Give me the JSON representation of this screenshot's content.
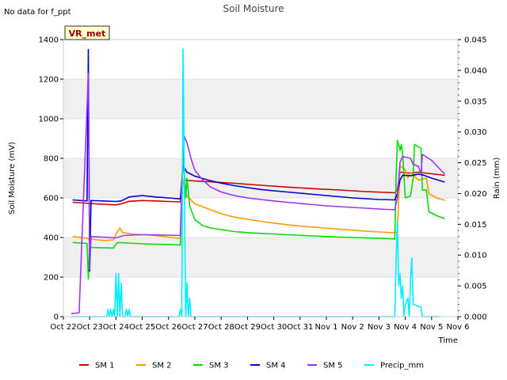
{
  "top_note": "No data for f_ppt",
  "station_badge": "VR_met",
  "chart_data": {
    "type": "line",
    "title": "Soil Moisture",
    "xlabel": "Time",
    "ylabel": "Soil Moisture (mV)",
    "y2label": "Rain (mm)",
    "x_tick_labels": [
      "Oct 22",
      "Oct 23",
      "Oct 24",
      "Oct 25",
      "Oct 26",
      "Oct 27",
      "Oct 28",
      "Oct 29",
      "Oct 30",
      "Oct 31",
      "Nov 1",
      "Nov 2",
      "Nov 3",
      "Nov 4",
      "Nov 5",
      "Nov 6"
    ],
    "xlim": [
      0,
      15
    ],
    "ylim": [
      0,
      1400
    ],
    "y_ticks": [
      0,
      200,
      400,
      600,
      800,
      1000,
      1200,
      1400
    ],
    "y2lim": [
      0,
      0.045
    ],
    "y2_ticks": [
      "0.000",
      "0.005",
      "0.010",
      "0.015",
      "0.020",
      "0.025",
      "0.030",
      "0.035",
      "0.040",
      "0.045"
    ],
    "grid": true,
    "legend_position": "bottom",
    "series": [
      {
        "name": "SM 1",
        "color": "#cc0000",
        "axis": "left",
        "points": [
          [
            0.35,
            578
          ],
          [
            1,
            572
          ],
          [
            1.5,
            568
          ],
          [
            2,
            565
          ],
          [
            2.2,
            570
          ],
          [
            2.5,
            583
          ],
          [
            3,
            587
          ],
          [
            3.5,
            585
          ],
          [
            4,
            582
          ],
          [
            4.45,
            580
          ],
          [
            4.55,
            690
          ],
          [
            4.7,
            688
          ],
          [
            5.5,
            682
          ],
          [
            6.5,
            674
          ],
          [
            7.5,
            664
          ],
          [
            8.5,
            655
          ],
          [
            9.5,
            647
          ],
          [
            10.5,
            640
          ],
          [
            11.5,
            632
          ],
          [
            12.6,
            626
          ],
          [
            12.7,
            640
          ],
          [
            12.8,
            730
          ],
          [
            13.2,
            725
          ],
          [
            13.5,
            730
          ],
          [
            14,
            722
          ],
          [
            14.5,
            714
          ]
        ]
      },
      {
        "name": "SM 2",
        "color": "#ff9900",
        "axis": "left",
        "points": [
          [
            0.35,
            405
          ],
          [
            0.8,
            398
          ],
          [
            1,
            392
          ],
          [
            1.3,
            388
          ],
          [
            1.6,
            385
          ],
          [
            1.9,
            388
          ],
          [
            2.05,
            430
          ],
          [
            2.15,
            448
          ],
          [
            2.25,
            425
          ],
          [
            2.6,
            418
          ],
          [
            3,
            415
          ],
          [
            3.5,
            410
          ],
          [
            4,
            402
          ],
          [
            4.45,
            395
          ],
          [
            4.55,
            690
          ],
          [
            4.7,
            610
          ],
          [
            5,
            570
          ],
          [
            5.5,
            545
          ],
          [
            6,
            520
          ],
          [
            6.5,
            503
          ],
          [
            7,
            492
          ],
          [
            7.5,
            482
          ],
          [
            8,
            473
          ],
          [
            8.5,
            465
          ],
          [
            9,
            458
          ],
          [
            9.5,
            452
          ],
          [
            10,
            447
          ],
          [
            10.5,
            442
          ],
          [
            11,
            437
          ],
          [
            11.5,
            432
          ],
          [
            12,
            428
          ],
          [
            12.6,
            424
          ],
          [
            12.7,
            430
          ],
          [
            12.8,
            760
          ],
          [
            13,
            745
          ],
          [
            13.1,
            700
          ],
          [
            13.2,
            730
          ],
          [
            13.5,
            690
          ],
          [
            13.8,
            700
          ],
          [
            13.9,
            620
          ],
          [
            14.2,
            600
          ],
          [
            14.5,
            588
          ]
        ]
      },
      {
        "name": "SM 3",
        "color": "#00dd00",
        "axis": "left",
        "points": [
          [
            0.35,
            375
          ],
          [
            0.9,
            370
          ],
          [
            0.95,
            190
          ],
          [
            1,
            350
          ],
          [
            1.5,
            348
          ],
          [
            1.9,
            347
          ],
          [
            2.05,
            375
          ],
          [
            2.5,
            372
          ],
          [
            3,
            368
          ],
          [
            3.5,
            366
          ],
          [
            4,
            365
          ],
          [
            4.45,
            362
          ],
          [
            4.5,
            660
          ],
          [
            4.55,
            850
          ],
          [
            4.65,
            600
          ],
          [
            4.7,
            700
          ],
          [
            4.8,
            560
          ],
          [
            5,
            490
          ],
          [
            5.3,
            460
          ],
          [
            5.6,
            448
          ],
          [
            6,
            440
          ],
          [
            6.5,
            430
          ],
          [
            7,
            425
          ],
          [
            7.5,
            421
          ],
          [
            8,
            418
          ],
          [
            8.5,
            414
          ],
          [
            9,
            411
          ],
          [
            9.5,
            408
          ],
          [
            10,
            405
          ],
          [
            10.5,
            402
          ],
          [
            11,
            400
          ],
          [
            11.5,
            398
          ],
          [
            12,
            396
          ],
          [
            12.6,
            393
          ],
          [
            12.65,
            700
          ],
          [
            12.7,
            890
          ],
          [
            12.75,
            870
          ],
          [
            12.8,
            840
          ],
          [
            12.85,
            870
          ],
          [
            12.9,
            820
          ],
          [
            13.0,
            600
          ],
          [
            13.2,
            610
          ],
          [
            13.3,
            700
          ],
          [
            13.35,
            870
          ],
          [
            13.6,
            850
          ],
          [
            13.65,
            640
          ],
          [
            13.8,
            640
          ],
          [
            13.9,
            530
          ],
          [
            14.2,
            510
          ],
          [
            14.5,
            495
          ]
        ]
      },
      {
        "name": "SM 4",
        "color": "#0000cc",
        "axis": "left",
        "points": [
          [
            0.35,
            590
          ],
          [
            0.9,
            585
          ],
          [
            0.95,
            1350
          ],
          [
            1.0,
            230
          ],
          [
            1.05,
            587
          ],
          [
            1.5,
            585
          ],
          [
            2,
            582
          ],
          [
            2.2,
            585
          ],
          [
            2.5,
            605
          ],
          [
            3,
            612
          ],
          [
            3.5,
            605
          ],
          [
            4,
            600
          ],
          [
            4.45,
            595
          ],
          [
            4.55,
            760
          ],
          [
            4.7,
            730
          ],
          [
            5,
            710
          ],
          [
            5.5,
            690
          ],
          [
            6,
            675
          ],
          [
            6.5,
            662
          ],
          [
            7,
            652
          ],
          [
            7.5,
            643
          ],
          [
            8,
            636
          ],
          [
            8.5,
            630
          ],
          [
            9,
            624
          ],
          [
            9.5,
            618
          ],
          [
            10,
            612
          ],
          [
            10.5,
            606
          ],
          [
            11,
            600
          ],
          [
            11.5,
            596
          ],
          [
            12,
            592
          ],
          [
            12.6,
            590
          ],
          [
            12.7,
            620
          ],
          [
            12.8,
            690
          ],
          [
            12.9,
            715
          ],
          [
            13.2,
            712
          ],
          [
            13.3,
            715
          ],
          [
            13.5,
            720
          ],
          [
            13.7,
            715
          ],
          [
            14,
            700
          ],
          [
            14.5,
            680
          ]
        ]
      },
      {
        "name": "SM 5",
        "color": "#9933ff",
        "axis": "left",
        "points": [
          [
            0.3,
            15
          ],
          [
            0.5,
            18
          ],
          [
            0.6,
            20
          ],
          [
            0.95,
            1230
          ],
          [
            1.0,
            240
          ],
          [
            1.05,
            405
          ],
          [
            1.5,
            402
          ],
          [
            2,
            398
          ],
          [
            2.3,
            410
          ],
          [
            2.6,
            412
          ],
          [
            3,
            414
          ],
          [
            3.5,
            413
          ],
          [
            4,
            412
          ],
          [
            4.45,
            410
          ],
          [
            4.5,
            650
          ],
          [
            4.6,
            910
          ],
          [
            4.7,
            880
          ],
          [
            4.85,
            800
          ],
          [
            5,
            740
          ],
          [
            5.3,
            690
          ],
          [
            5.6,
            655
          ],
          [
            6,
            630
          ],
          [
            6.5,
            612
          ],
          [
            7,
            600
          ],
          [
            7.5,
            592
          ],
          [
            8,
            585
          ],
          [
            8.5,
            578
          ],
          [
            9,
            572
          ],
          [
            9.5,
            566
          ],
          [
            10,
            560
          ],
          [
            10.5,
            556
          ],
          [
            11,
            552
          ],
          [
            11.5,
            548
          ],
          [
            12,
            544
          ],
          [
            12.6,
            540
          ],
          [
            12.7,
            600
          ],
          [
            12.8,
            780
          ],
          [
            12.9,
            810
          ],
          [
            13.2,
            800
          ],
          [
            13.3,
            770
          ],
          [
            13.5,
            760
          ],
          [
            13.6,
            720
          ],
          [
            13.65,
            820
          ],
          [
            14,
            790
          ],
          [
            14.5,
            720
          ]
        ]
      },
      {
        "name": "Precip_mm",
        "color": "#00eeff",
        "axis": "right",
        "points": [
          [
            0.3,
            0
          ],
          [
            1.65,
            0
          ],
          [
            1.7,
            0.0012
          ],
          [
            1.75,
            0
          ],
          [
            1.8,
            0.0012
          ],
          [
            1.85,
            0
          ],
          [
            1.9,
            0.0012
          ],
          [
            1.95,
            0
          ],
          [
            2.0,
            0.007
          ],
          [
            2.05,
            0
          ],
          [
            2.1,
            0.007
          ],
          [
            2.15,
            0
          ],
          [
            2.2,
            0.0055
          ],
          [
            2.25,
            0
          ],
          [
            2.35,
            0
          ],
          [
            2.4,
            0.0012
          ],
          [
            2.45,
            0
          ],
          [
            2.5,
            0.0012
          ],
          [
            2.55,
            0
          ],
          [
            4.4,
            0
          ],
          [
            4.45,
            0.0012
          ],
          [
            4.5,
            0
          ],
          [
            4.55,
            0.0435
          ],
          [
            4.6,
            0.022
          ],
          [
            4.65,
            0
          ],
          [
            4.7,
            0.0055
          ],
          [
            4.75,
            0
          ],
          [
            4.8,
            0.003
          ],
          [
            4.85,
            0
          ],
          [
            12.6,
            0
          ],
          [
            12.65,
            0.009
          ],
          [
            12.7,
            0.0155
          ],
          [
            12.75,
            0.005
          ],
          [
            12.8,
            0.007
          ],
          [
            12.85,
            0.003
          ],
          [
            12.9,
            0.005
          ],
          [
            12.95,
            0
          ],
          [
            13.0,
            0.002
          ],
          [
            13.1,
            0.003
          ],
          [
            13.15,
            0
          ],
          [
            13.2,
            0.006
          ],
          [
            13.25,
            0.0095
          ],
          [
            13.3,
            0.002
          ],
          [
            13.6,
            0.0015
          ],
          [
            13.65,
            0
          ],
          [
            14.3,
            0
          ]
        ]
      }
    ]
  }
}
